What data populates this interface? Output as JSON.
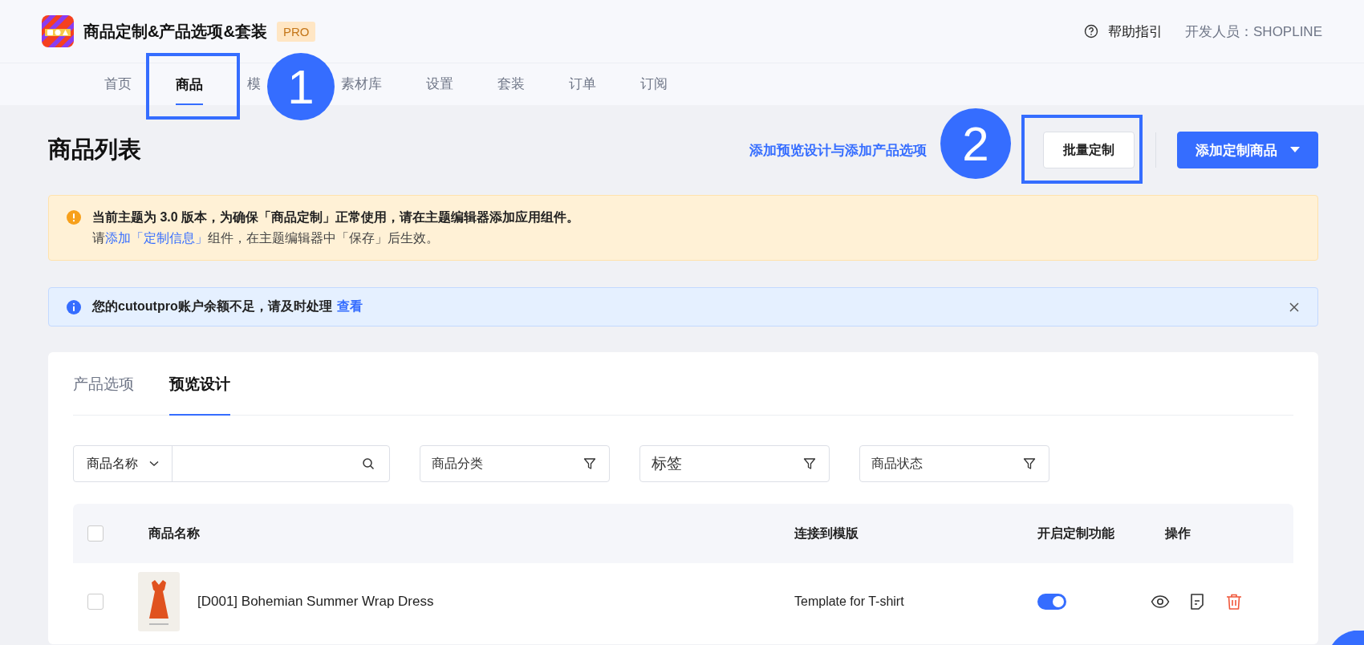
{
  "app": {
    "title": "商品定制&产品选项&套装",
    "badge": "PRO",
    "help": "帮助指引",
    "developer": "开发人员：SHOPLINE"
  },
  "nav": [
    {
      "label": "首页",
      "selected": false
    },
    {
      "label": "商品",
      "selected": true
    },
    {
      "label": "模",
      "selected": false
    },
    {
      "label": "素材库",
      "selected": false
    },
    {
      "label": "设置",
      "selected": false
    },
    {
      "label": "套装",
      "selected": false
    },
    {
      "label": "订单",
      "selected": false
    },
    {
      "label": "订阅",
      "selected": false
    }
  ],
  "page": {
    "title": "商品列表",
    "link": "添加预览设计与添加产品选项",
    "batch_button": "批量定制",
    "primary_button": "添加定制商品"
  },
  "warning": {
    "line1": "当前主题为 3.0 版本，为确保「商品定制」正常使用，请在主题编辑器添加应用组件。",
    "line2_prefix": "请",
    "line2_link": "添加「定制信息」",
    "line2_suffix": "组件，在主题编辑器中「保存」后生效。"
  },
  "notice": {
    "text": "您的cutoutpro账户余额不足，请及时处理",
    "link": "查看"
  },
  "tabs": [
    {
      "label": "产品选项",
      "selected": false
    },
    {
      "label": "预览设计",
      "selected": true
    }
  ],
  "filters": {
    "search_select": "商品名称",
    "selects": [
      "商品分类",
      "标签",
      "商品状态"
    ]
  },
  "table": {
    "header_checked": false,
    "columns": [
      "商品名称",
      "连接到模版",
      "开启定制功能",
      "操作"
    ],
    "rows": [
      {
        "checked": false,
        "name": "[D001] Bohemian Summer Wrap Dress",
        "template": "Template for T-shirt",
        "enabled": true
      }
    ]
  },
  "annotations": [
    {
      "label": "1"
    },
    {
      "label": "2"
    }
  ]
}
